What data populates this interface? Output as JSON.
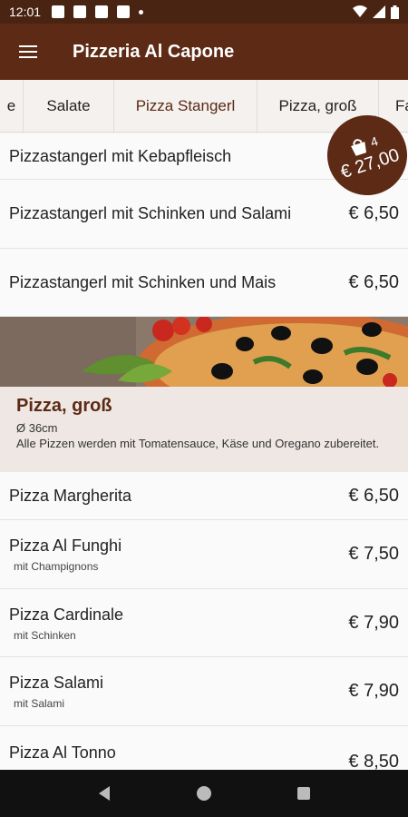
{
  "status": {
    "time": "12:01"
  },
  "header": {
    "title": "Pizzeria Al Capone"
  },
  "tabs": [
    {
      "label": "e"
    },
    {
      "label": "Salate"
    },
    {
      "label": "Pizza Stangerl"
    },
    {
      "label": "Pizza, groß"
    },
    {
      "label": "Fa"
    }
  ],
  "cart": {
    "count": "4",
    "total": "€ 27,00"
  },
  "items_top": [
    {
      "name": "Pizzastangerl mit Kebapfleisch",
      "price": ""
    },
    {
      "name": "Pizzastangerl mit Schinken und Salami",
      "price": "€ 6,50"
    },
    {
      "name": "Pizzastangerl mit Schinken und Mais",
      "price": "€ 6,50"
    }
  ],
  "category": {
    "title": "Pizza, groß",
    "size": "Ø 36cm",
    "note": "Alle Pizzen werden mit Tomatensauce, Käse und Oregano zubereitet."
  },
  "items_pizza": [
    {
      "name": "Pizza Margherita",
      "desc": "",
      "price": "€ 6,50"
    },
    {
      "name": "Pizza Al Funghi",
      "desc": "mit Champignons",
      "price": "€ 7,50"
    },
    {
      "name": "Pizza Cardinale",
      "desc": "mit Schinken",
      "price": "€ 7,90"
    },
    {
      "name": "Pizza Salami",
      "desc": "mit Salami",
      "price": "€ 7,90"
    },
    {
      "name": "Pizza Al Tonno",
      "desc": "",
      "price": "€ 8,50"
    }
  ],
  "colors": {
    "brand": "#5c2a15",
    "accent": "#4a2412"
  }
}
